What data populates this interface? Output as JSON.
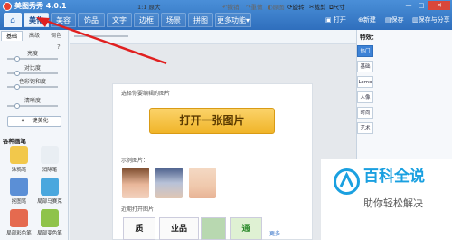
{
  "app": {
    "title": "美图秀秀 4.0.1"
  },
  "menu": {
    "tabs": [
      {
        "label": "美化"
      },
      {
        "label": "美容"
      },
      {
        "label": "饰品"
      },
      {
        "label": "文字"
      },
      {
        "label": "边框"
      },
      {
        "label": "场景"
      },
      {
        "label": "拼图"
      },
      {
        "label": "更多功能"
      }
    ],
    "actions": [
      {
        "label": "打开"
      },
      {
        "label": "新建"
      },
      {
        "label": "保存"
      },
      {
        "label": "保存与分享"
      }
    ]
  },
  "left_panel": {
    "subtabs": [
      {
        "label": "基础"
      },
      {
        "label": "高级"
      },
      {
        "label": "调色"
      }
    ],
    "sliders": [
      {
        "label": "亮度",
        "value": 0.2
      },
      {
        "label": "对比度",
        "value": 0.2
      },
      {
        "label": "色彩饱和度",
        "value": 0.2
      },
      {
        "label": "清晰度",
        "value": 0.2
      }
    ],
    "auto_beautify": "一键美化",
    "pen_section_title": "各种画笔",
    "tools": [
      {
        "label": "涂鸦笔",
        "color": "#f2c84b"
      },
      {
        "label": "消除笔",
        "color": "#e9eef3"
      },
      {
        "label": "抠图笔",
        "color": "#5b8fd6"
      },
      {
        "label": "局部马赛克",
        "color": "#4aa7de"
      },
      {
        "label": "局部彩色笔",
        "color": "#e56a4f"
      },
      {
        "label": "局部变色笔",
        "color": "#8fc34a"
      }
    ]
  },
  "toolbar": {
    "zoom_label": "1:1",
    "zoom_tail": "原大",
    "items": [
      {
        "label": "撤销"
      },
      {
        "label": "重做"
      },
      {
        "label": "原图"
      },
      {
        "label": "旋转"
      },
      {
        "label": "裁剪"
      },
      {
        "label": "尺寸"
      }
    ]
  },
  "canvas": {
    "choose_text": "选择你要编辑的图片",
    "open_button": "打开一张图片",
    "sample_label": "示例图片：",
    "recent_label": "近期打开图片：",
    "recent_items": [
      {
        "label": "质"
      },
      {
        "label": "业品"
      },
      {
        "label": "通"
      }
    ],
    "more": "更多"
  },
  "right_panel": {
    "title": "特效：",
    "tabs": [
      {
        "label": "热门"
      },
      {
        "label": "基础"
      },
      {
        "label": "Lomo"
      },
      {
        "label": "人像"
      },
      {
        "label": "时尚"
      },
      {
        "label": "艺术"
      }
    ]
  },
  "watermark": {
    "title": "百科全说",
    "subtitle": "助你轻松解决"
  }
}
